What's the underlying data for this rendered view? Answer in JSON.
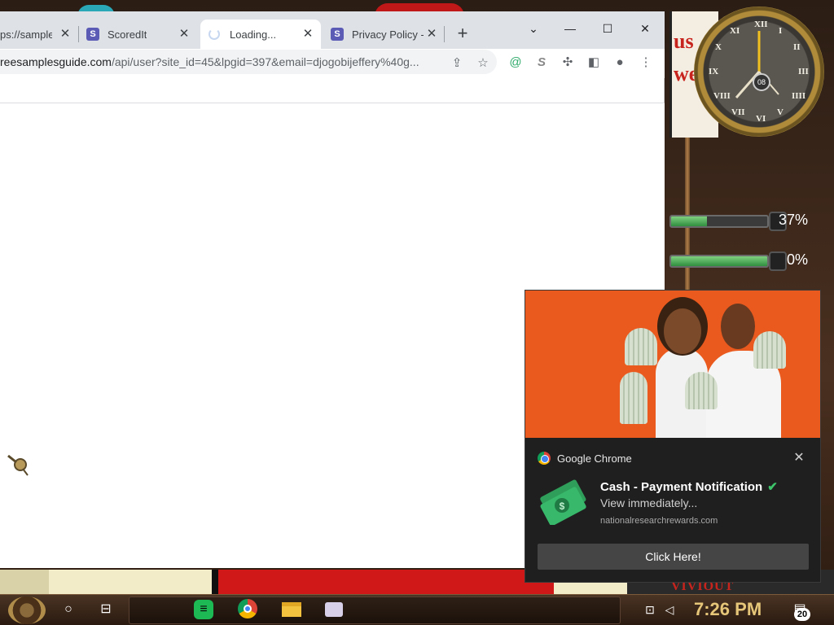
{
  "browser": {
    "tabs": [
      {
        "label": "ps://sample",
        "favicon": "",
        "active": false
      },
      {
        "label": "ScoredIt",
        "favicon": "S",
        "active": false
      },
      {
        "label": "Loading...",
        "favicon": "spinner",
        "active": true
      },
      {
        "label": "Privacy Policy -",
        "favicon": "S",
        "active": false
      }
    ],
    "new_tab": "+",
    "window_controls": {
      "tab_search": "⌄",
      "minimize": "—",
      "maximize": "☐",
      "close": "✕"
    },
    "address": {
      "host": "reesamplesguide.com",
      "path": "/api/user?site_id=45&lpgid=397&email=djogobijeffery%40g..."
    },
    "toolbar_icons": [
      "share-icon",
      "star-icon",
      "extension-icon",
      "s-extension-icon",
      "puzzle-icon",
      "sidepanel-icon",
      "profile-icon",
      "menu-icon"
    ]
  },
  "desktop": {
    "poster_text": "us\nwe",
    "clock_numerals": [
      "XII",
      "I",
      "II",
      "III",
      "IIII",
      "V",
      "VI",
      "VII",
      "VIII",
      "IX",
      "X",
      "XI"
    ],
    "clock_day": "08",
    "meters": [
      {
        "label": "37%",
        "value": 0.37
      },
      {
        "label": "0%",
        "value": 0.0
      }
    ],
    "bottom_text": "VIVIOUT"
  },
  "notification": {
    "app_name": "Google Chrome",
    "title": "Cash - Payment Notification",
    "body": "View immediately...",
    "domain": "nationalresearchrewards.com",
    "action_label": "Click Here!",
    "close": "✕",
    "check_color": "#3dc46a"
  },
  "taskbar": {
    "time": "7:26 PM",
    "notification_count": "20",
    "apps": [
      "cortana-icon",
      "task-view-icon",
      "spotify-icon",
      "chrome-icon",
      "file-explorer-icon",
      "app-icon"
    ]
  }
}
